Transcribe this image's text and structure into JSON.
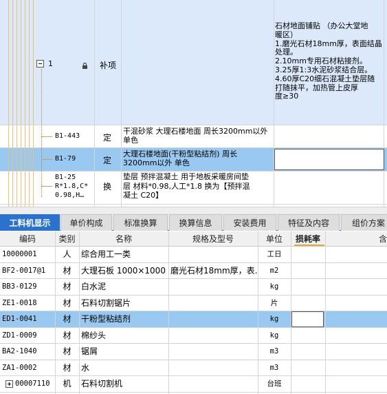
{
  "top_grid": {
    "group_row": {
      "number": "1",
      "type": "补项",
      "description_lines": [
        "石材地面铺贴 （办公大堂地",
        "暖区）",
        "1.磨光石材18mm厚，表面结晶",
        "处理。",
        "2.10mm专用石材粘接剂。",
        "3.25厚1:3水泥砂浆结合层。",
        "4.60厚C20细石混凝土垫层随",
        "打随抹平，加热管上皮厚",
        "度≥30"
      ]
    },
    "rows": [
      {
        "code": "B1-443",
        "category": "定",
        "name_lines": [
          "干混砂浆 大理石楼地面 周长3200mm以外",
          "单色"
        ]
      },
      {
        "code": "B1-79",
        "category": "定",
        "name_lines": [
          "大理石楼地面(干粉型粘结剂) 周长",
          "3200mm以外 单色"
        ]
      },
      {
        "code_lines": [
          "B1-25",
          "R*1.8,C*",
          "0.98,H…"
        ],
        "category": "换",
        "name_lines": [
          "垫层 预拌混凝土  用于地板采暖房间垫",
          "层 材料*0.98,人工*1.8  换为【预拌混",
          "凝土 C20】"
        ]
      }
    ]
  },
  "tabs": [
    "工料机显示",
    "单价构成",
    "标准换算",
    "换算信息",
    "安装费用",
    "特征及内容",
    "组价方案"
  ],
  "table": {
    "headers": [
      "编码",
      "类别",
      "名称",
      "规格及型号",
      "单位",
      "损耗率",
      "含"
    ],
    "rows": [
      {
        "code": "10000001",
        "type": "人",
        "name": "综合用工一类",
        "spec": "",
        "unit": "工日"
      },
      {
        "code": "BF2-0017@1",
        "type": "材",
        "name": "大理石板 1000×1000",
        "spec": "磨光石材18mm厚，表…",
        "unit": "m2"
      },
      {
        "code": "BB3-0129",
        "type": "材",
        "name": "白水泥",
        "spec": "",
        "unit": "kg"
      },
      {
        "code": "ZE1-0018",
        "type": "材",
        "name": "石料切割锯片",
        "spec": "",
        "unit": "片"
      },
      {
        "code": "ED1-0041",
        "type": "材",
        "name": "干粉型粘结剂",
        "spec": "",
        "unit": "kg"
      },
      {
        "code": "ZD1-0009",
        "type": "材",
        "name": "棉纱头",
        "spec": "",
        "unit": "kg"
      },
      {
        "code": "BA2-1040",
        "type": "材",
        "name": "锯屑",
        "spec": "",
        "unit": "m3"
      },
      {
        "code": "ZA1-0002",
        "type": "材",
        "name": "水",
        "spec": "",
        "unit": "m3"
      },
      {
        "code": "00007110",
        "type": "机",
        "name": "石料切割机",
        "spec": "",
        "unit": "台班"
      }
    ]
  },
  "colors": {
    "tab_active": "#2a72d0",
    "row_selected": "#99c8f0",
    "group_bg": "#dbe9fb"
  },
  "icons": {
    "collapse": "minus-box-icon",
    "lock": "lock-icon",
    "expand": "plus-box-icon"
  }
}
